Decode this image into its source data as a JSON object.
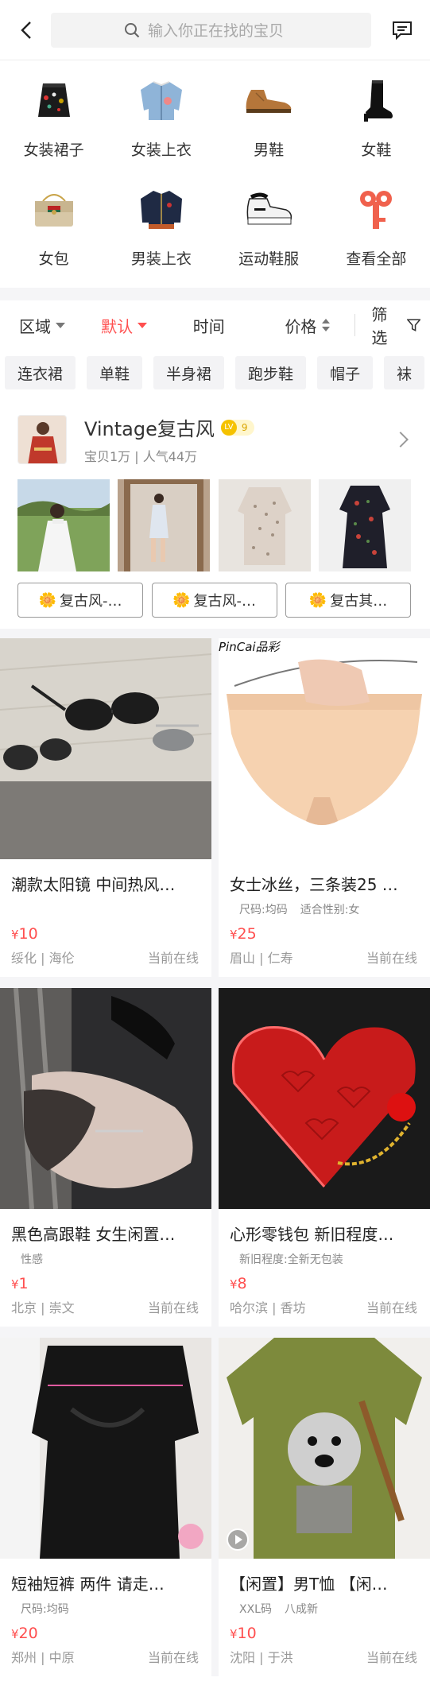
{
  "header": {
    "search_placeholder": "输入你正在找的宝贝",
    "back_icon": "chevron-left-icon",
    "message_icon": "message-icon"
  },
  "categories": [
    {
      "label": "女装裙子",
      "icon": "skirt-icon"
    },
    {
      "label": "女装上衣",
      "icon": "jacket-icon"
    },
    {
      "label": "男鞋",
      "icon": "men-shoe-icon"
    },
    {
      "label": "女鞋",
      "icon": "boot-icon"
    },
    {
      "label": "女包",
      "icon": "handbag-icon"
    },
    {
      "label": "男装上衣",
      "icon": "bomber-jacket-icon"
    },
    {
      "label": "运动鞋服",
      "icon": "sneaker-icon"
    },
    {
      "label": "查看全部",
      "icon": "key-icon"
    }
  ],
  "filters": {
    "region": "区域",
    "default": "默认",
    "time": "时间",
    "price": "价格",
    "screen": "筛选"
  },
  "tags": [
    "连衣裙",
    "单鞋",
    "半身裙",
    "跑步鞋",
    "帽子",
    "袜"
  ],
  "shop": {
    "name": "Vintage复古风",
    "level": "9",
    "stats": "宝贝1万 | 人气44万",
    "buttons": [
      "复古风-…",
      "复古风-…",
      "复古其…"
    ]
  },
  "products": [
    {
      "title": "潮款太阳镜 中间热风…",
      "attrs": [],
      "price": "10",
      "location": "绥化 | 海伦",
      "status": "当前在线"
    },
    {
      "title": "女士冰丝，三条装25 …",
      "attrs": [
        "尺码:均码",
        "适合性别:女"
      ],
      "price": "25",
      "location": "眉山 | 仁寿",
      "status": "当前在线"
    },
    {
      "title": "黑色高跟鞋 女生闲置…",
      "attrs": [
        "性感"
      ],
      "price": "1",
      "location": "北京 | 崇文",
      "status": "当前在线"
    },
    {
      "title": "心形零钱包 新旧程度…",
      "attrs": [
        "新旧程度:全新无包装"
      ],
      "price": "8",
      "location": "哈尔滨 | 香坊",
      "status": "当前在线"
    },
    {
      "title": "短袖短裤 两件 请走…",
      "attrs": [
        "尺码:均码"
      ],
      "price": "20",
      "location": "郑州 | 中原",
      "status": "当前在线"
    },
    {
      "title": "【闲置】男T恤 【闲…",
      "attrs": [
        "XXL码",
        "八成新"
      ],
      "price": "10",
      "location": "沈阳 | 于洪",
      "status": "当前在线"
    }
  ],
  "image_texts": {
    "pincai": "PinCai品彩"
  },
  "colors": {
    "accent": "#ff4f4f"
  }
}
